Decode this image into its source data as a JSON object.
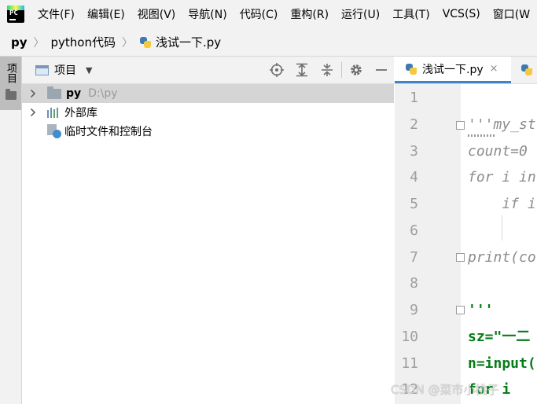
{
  "app": {
    "logo_text": "PC"
  },
  "menu": [
    "文件(F)",
    "编辑(E)",
    "视图(V)",
    "导航(N)",
    "代码(C)",
    "重构(R)",
    "运行(U)",
    "工具(T)",
    "VCS(S)",
    "窗口(W"
  ],
  "breadcrumb": {
    "root": "py",
    "folder": "python代码",
    "file": "浅试一下.py"
  },
  "toolstrip": {
    "project_tab": "项目"
  },
  "project_panel": {
    "title": "项目",
    "tree": {
      "root": {
        "name": "py",
        "path": "D:\\py"
      },
      "external_libs": "外部库",
      "scratches": "临时文件和控制台"
    }
  },
  "editor": {
    "active_tab": "浅试一下.py",
    "close_glyph": "×",
    "line_numbers": [
      "1",
      "2",
      "3",
      "4",
      "5",
      "6",
      "7",
      "8",
      "9",
      "10",
      "11",
      "12"
    ],
    "lines": {
      "l2": "'''my_st",
      "l3": "count=0",
      "l4": "for i in",
      "l5": "    if i",
      "l7": "print(co",
      "l9": "'''",
      "l10": "sz=\"一二",
      "l11": "n=input(",
      "l12": "for i"
    }
  },
  "watermark": "CSDN @菜市小桃子"
}
